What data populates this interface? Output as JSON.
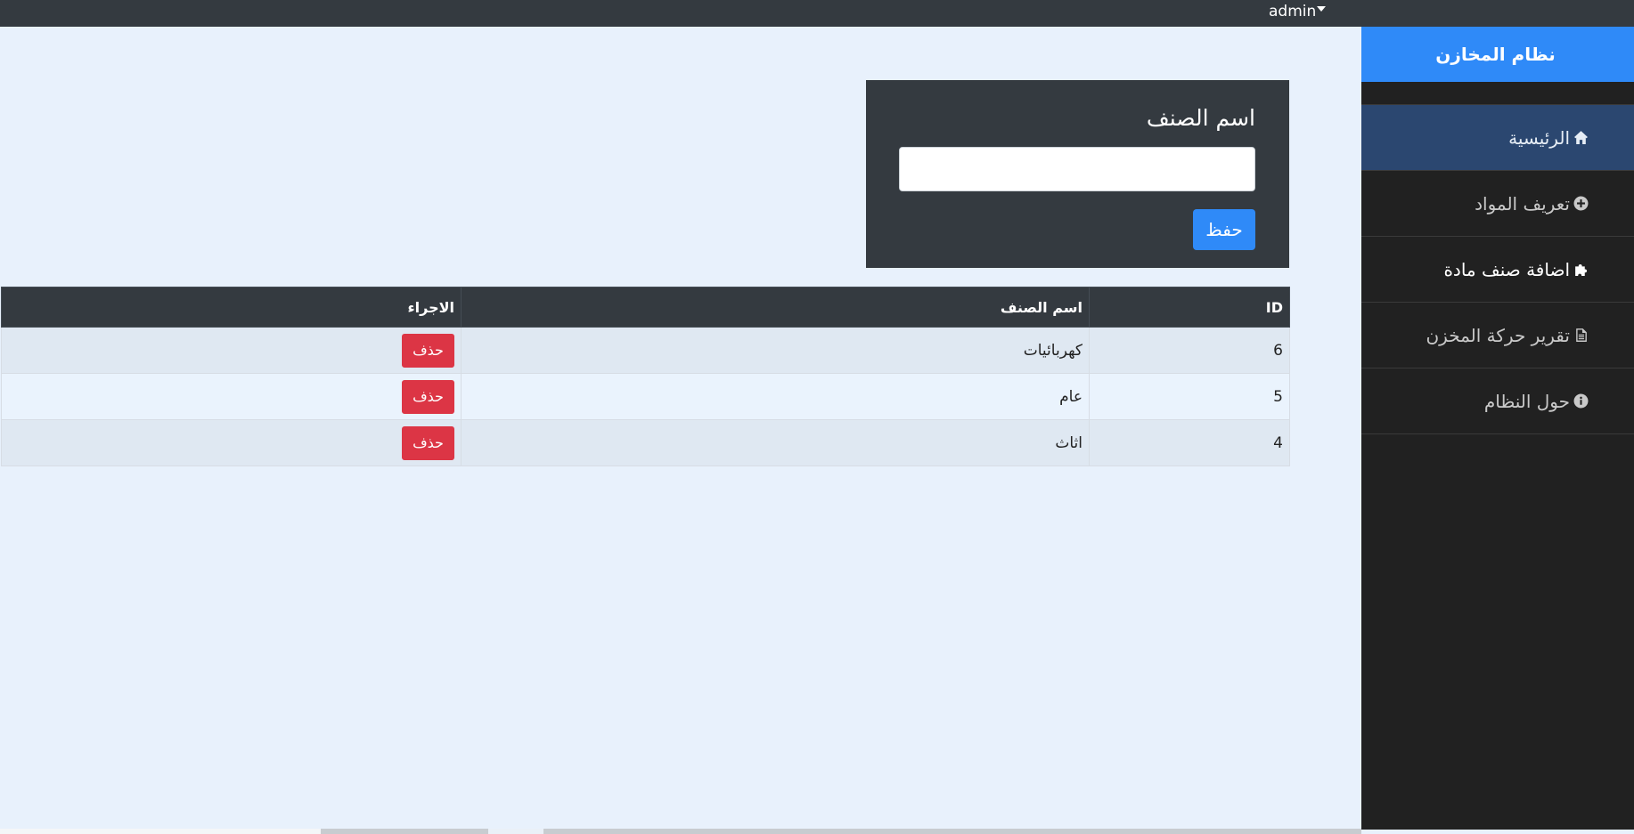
{
  "topbar": {
    "user_label": "admin"
  },
  "sidebar": {
    "brand": "نظام المخازن",
    "items": [
      {
        "label": "الرئيسية",
        "icon": "home-icon"
      },
      {
        "label": "تعريف المواد",
        "icon": "plus-circle-icon"
      },
      {
        "label": "اضافة صنف مادة",
        "icon": "puzzle-icon"
      },
      {
        "label": "تقرير حركة المخزن",
        "icon": "file-text-icon"
      },
      {
        "label": "حول النظام",
        "icon": "info-circle-icon"
      }
    ]
  },
  "form": {
    "field_label": "اسم الصنف",
    "input_value": "",
    "save_label": "حفظ"
  },
  "table": {
    "headers": {
      "id": "ID",
      "name": "اسم الصنف",
      "action": "الاجراء"
    },
    "rows": [
      {
        "id": "6",
        "name": "كهربائيات",
        "action": "حذف"
      },
      {
        "id": "5",
        "name": "عام",
        "action": "حذف"
      },
      {
        "id": "4",
        "name": "اثاث",
        "action": "حذف"
      }
    ]
  },
  "colors": {
    "topbar": "#343a40",
    "sidebar": "#212121",
    "brand": "#2f8af8",
    "active_item": "#2b4770",
    "primary_button": "#2f8af8",
    "danger_button": "#dc3545",
    "page_background": "#e8f1fc"
  }
}
